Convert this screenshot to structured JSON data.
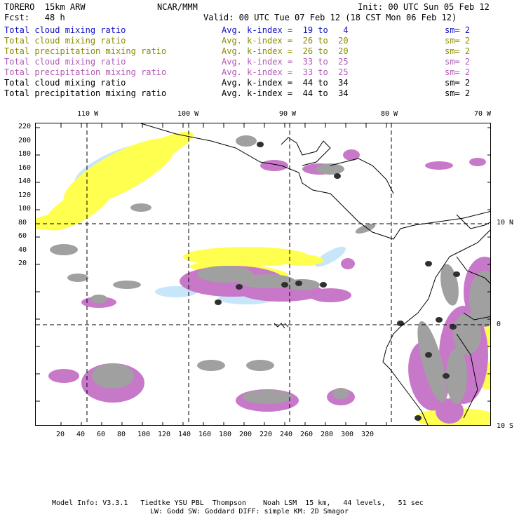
{
  "header": {
    "model": "TORERO  15km ARW",
    "org": "NCAR/MMM",
    "init": "Init: 00 UTC Sun 05 Feb 12",
    "fcst": "Fcst:   48 h",
    "valid": "Valid: 00 UTC Tue 07 Feb 12 (18 CST Mon 06 Feb 12)"
  },
  "legend": [
    {
      "name": "Total cloud mixing ratio",
      "kindex": "Avg. k-index =  19 to   4",
      "sm": "sm= 2",
      "color": "#1010c8"
    },
    {
      "name": "Total cloud mixing ratio",
      "kindex": "Avg. k-index =  26 to  20",
      "sm": "sm= 2",
      "color": "#8c8c00"
    },
    {
      "name": "Total precipitation mixing ratio",
      "kindex": "Avg. k-index =  26 to  20",
      "sm": "sm= 2",
      "color": "#8c8c00"
    },
    {
      "name": "Total cloud mixing ratio",
      "kindex": "Avg. k-index =  33 to  25",
      "sm": "sm= 2",
      "color": "#b45ab4"
    },
    {
      "name": "Total precipitation mixing ratio",
      "kindex": "Avg. k-index =  33 to  25",
      "sm": "sm= 2",
      "color": "#b45ab4"
    },
    {
      "name": "Total cloud mixing ratio",
      "kindex": "Avg. k-index =  44 to  34",
      "sm": "sm= 2",
      "color": "#000000"
    },
    {
      "name": "Total precipitation mixing ratio",
      "kindex": "Avg. k-index =  44 to  34",
      "sm": "sm= 2",
      "color": "#000000"
    }
  ],
  "map": {
    "top_lon_labels": [
      "110 W",
      "100 W",
      "90 W",
      "80 W",
      "70 W"
    ],
    "right_lat_labels": [
      "10 N",
      "0",
      "10 S"
    ],
    "left_y_labels": [
      "220",
      "200",
      "180",
      "160",
      "140",
      "120",
      "100",
      "80",
      "60",
      "40",
      "20"
    ],
    "bottom_x_labels": [
      "20",
      "40",
      "60",
      "80",
      "100",
      "120",
      "140",
      "160",
      "180",
      "200",
      "220",
      "240",
      "260",
      "280",
      "300",
      "320"
    ],
    "colors": {
      "light_blue": "#c8e6fa",
      "yellow": "#ffff50",
      "purple": "#c878c8",
      "gray": "#a0a0a0",
      "dark": "#303030"
    }
  },
  "footer": {
    "line1": "Model Info: V3.3.1   Tiedtke YSU PBL  Thompson    Noah LSM  15 km,   44 levels,   51 sec",
    "line2": "LW: Godd SW: Goddard DIFF: simple KM: 2D Smagor"
  }
}
